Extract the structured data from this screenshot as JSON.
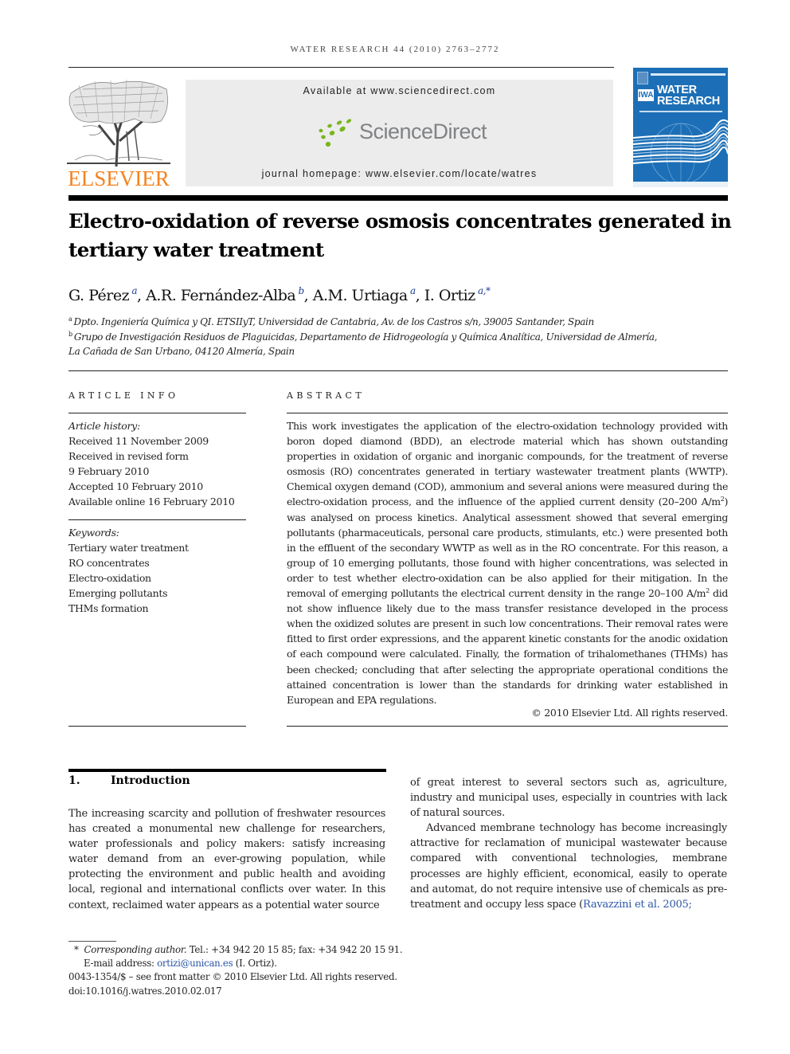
{
  "journal_header": "WATER RESEARCH 44 (2010) 2763–2772",
  "publisher": {
    "name": "ELSEVIER",
    "logo_icon": "elsevier-tree-icon",
    "brand_color": "#f5821f"
  },
  "banner": {
    "available_at": "Available at www.sciencedirect.com",
    "platform": "ScienceDirect",
    "platform_color": "#808285",
    "platform_accent": "#7ab51d",
    "homepage": "journal homepage: www.elsevier.com/locate/watres"
  },
  "cover": {
    "badge": "IWA",
    "title_line1": "WATER",
    "title_line2": "RESEARCH",
    "color": "#1c6fb6"
  },
  "article": {
    "title": "Electro-oxidation of reverse osmosis concentrates generated in tertiary water treatment",
    "authors": [
      {
        "name": "G. Pérez",
        "affil": "a",
        "separator": ", "
      },
      {
        "name": "A.R. Fernández-Alba",
        "affil": "b",
        "separator": ", "
      },
      {
        "name": "A.M. Urtiaga",
        "affil": "a",
        "separator": ", "
      },
      {
        "name": "I. Ortiz",
        "affil": "a,*",
        "separator": ""
      }
    ],
    "affiliations": [
      {
        "mark": "a",
        "text": "Dpto. Ingeniería Química y QI. ETSIIyT, Universidad de Cantabria, Av. de los Castros s/n, 39005 Santander, Spain"
      },
      {
        "mark": "b",
        "text": "Grupo de Investigación Residuos de Plaguicidas, Departamento de Hidrogeología y Química Analítica, Universidad de Almería,",
        "continuation": "La Cañada de San Urbano, 04120 Almería, Spain"
      }
    ]
  },
  "article_info": {
    "heading": "ARTICLE INFO",
    "history_label": "Article history:",
    "history": [
      "Received 11 November 2009",
      "Received in revised form",
      "9 February 2010",
      "Accepted 10 February 2010",
      "Available online 16 February 2010"
    ],
    "keywords_label": "Keywords:",
    "keywords": [
      "Tertiary water treatment",
      "RO concentrates",
      "Electro-oxidation",
      "Emerging pollutants",
      "THMs formation"
    ]
  },
  "abstract": {
    "heading": "ABSTRACT",
    "part1": "This work investigates the application of the electro-oxidation technology provided with boron doped diamond (BDD), an electrode material which has shown outstanding properties in oxidation of organic and inorganic compounds, for the treatment of reverse osmosis (RO) concentrates generated in tertiary wastewater treatment plants (WWTP). Chemical oxygen demand (COD), ammonium and several anions were measured during the electro-oxidation process, and the influence of the applied current density (20–200 A/m",
    "sup1": "2",
    "part2": ") was analysed on process kinetics. Analytical assessment showed that several emerging pollutants (pharmaceuticals, personal care products, stimulants, etc.) were presented both in the effluent of the secondary WWTP as well as in the RO concentrate. For this reason, a group of 10 emerging pollutants, those found with higher concentrations, was selected in order to test whether electro-oxidation can be also applied for their mitigation. In the removal of emerging pollutants the electrical current density in the range 20–100 A/m",
    "sup2": "2",
    "part3": " did not show influence likely due to the mass transfer resistance developed in the process when the oxidized solutes are present in such low concentrations. Their removal rates were fitted to first order expressions, and the apparent kinetic constants for the anodic oxidation of each compound were calculated. Finally, the formation of trihalomethanes (THMs) has been checked; concluding that after selecting the appropriate operational conditions the attained concentration is lower than the standards for drinking water established in European and EPA regulations.",
    "copyright": "© 2010 Elsevier Ltd. All rights reserved."
  },
  "introduction": {
    "number": "1.",
    "heading": "Introduction",
    "para1_col1": "The increasing scarcity and pollution of freshwater resources has created a monumental new challenge for researchers, water professionals and policy makers: satisfy increasing water demand from an ever-growing population, while protecting the environment and public health and avoiding local, regional and international conflicts over water. In this context, reclaimed water appears as a potential water source",
    "para1_col2": "of great interest to several sectors such as, agriculture, industry and municipal uses, especially in countries with lack of natural sources.",
    "para2": "Advanced membrane technology has become increasingly attractive for reclamation of municipal wastewater because compared with conventional technologies, membrane processes are highly efficient, economical, easily to operate and automat, do not require intensive use of chemicals as pre-treatment and occupy less space (",
    "citation": "Ravazzini et al. 2005;",
    "link_color": "#2a56a5"
  },
  "footnotes": {
    "corresponding_mark": "*",
    "corresponding_label": "Corresponding author.",
    "contact": " Tel.: +34 942 20 15 85; fax: +34 942 20 15 91.",
    "email_label": "E-mail address: ",
    "email": "ortizi@unican.es",
    "email_suffix": " (I. Ortiz).",
    "front_matter": "0043-1354/$ – see front matter © 2010 Elsevier Ltd. All rights reserved.",
    "doi": "doi:10.1016/j.watres.2010.02.017"
  }
}
